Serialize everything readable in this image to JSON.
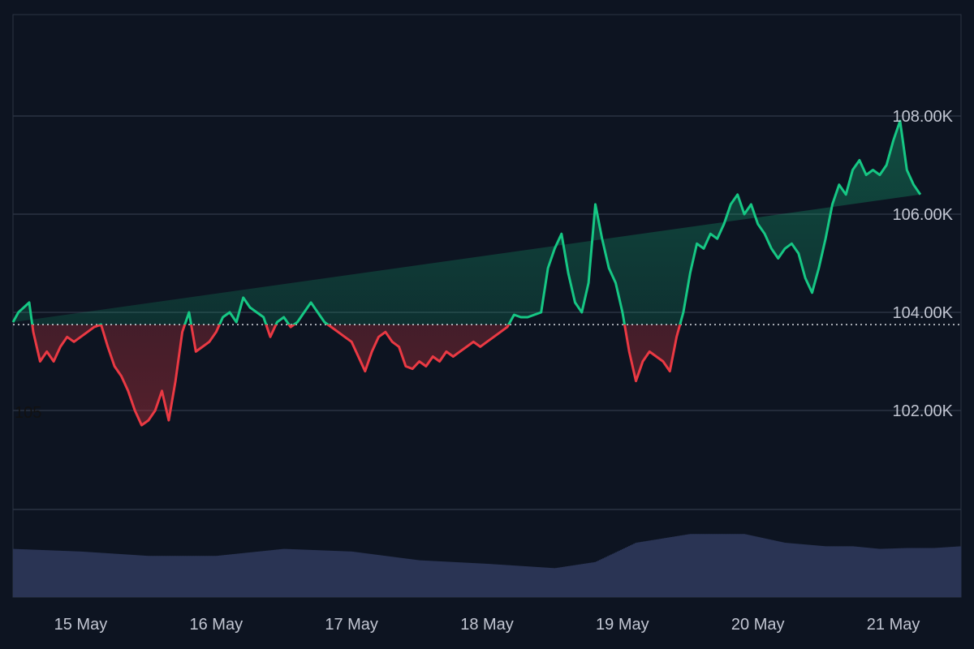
{
  "chart_data": {
    "type": "area",
    "baseline": 103.75,
    "y_unit_suffix": "K",
    "ylim": [
      100.0,
      110.0
    ],
    "y_ticks": [
      {
        "value": 102.0,
        "label": "102.00K"
      },
      {
        "value": 104.0,
        "label": "104.00K"
      },
      {
        "value": 106.0,
        "label": "106.00K"
      },
      {
        "value": 108.0,
        "label": "108.00K"
      }
    ],
    "stray_label": "105",
    "x_labels": [
      "15 May",
      "16 May",
      "17 May",
      "18 May",
      "19 May",
      "20 May",
      "21 May"
    ],
    "x_label_positions": [
      0.5,
      1.5,
      2.5,
      3.5,
      4.5,
      5.5,
      6.5
    ],
    "xlim": [
      0.0,
      7.0
    ],
    "grid": true,
    "colors": {
      "background": "#0d1421",
      "up": "#16c784",
      "down": "#ea3943",
      "up_fill": "#16c784",
      "down_fill": "#ea3943",
      "grid": "#2b3343",
      "baseline": "#d6d9e0",
      "volume": "#2a3454",
      "text": "#c2c6d2"
    },
    "price": {
      "x": [
        0.0,
        0.04,
        0.08,
        0.12,
        0.15,
        0.2,
        0.25,
        0.3,
        0.35,
        0.4,
        0.45,
        0.5,
        0.55,
        0.6,
        0.65,
        0.7,
        0.75,
        0.8,
        0.85,
        0.9,
        0.95,
        1.0,
        1.05,
        1.1,
        1.15,
        1.2,
        1.25,
        1.3,
        1.35,
        1.4,
        1.45,
        1.5,
        1.55,
        1.6,
        1.65,
        1.7,
        1.75,
        1.8,
        1.85,
        1.9,
        1.95,
        2.0,
        2.05,
        2.1,
        2.15,
        2.2,
        2.25,
        2.3,
        2.35,
        2.4,
        2.45,
        2.5,
        2.55,
        2.6,
        2.65,
        2.7,
        2.75,
        2.8,
        2.85,
        2.9,
        2.95,
        3.0,
        3.05,
        3.1,
        3.15,
        3.2,
        3.25,
        3.3,
        3.35,
        3.4,
        3.45,
        3.5,
        3.55,
        3.6,
        3.65,
        3.7,
        3.75,
        3.8,
        3.85,
        3.9,
        3.95,
        4.0,
        4.05,
        4.1,
        4.15,
        4.2,
        4.25,
        4.3,
        4.35,
        4.4,
        4.45,
        4.5,
        4.55,
        4.6,
        4.65,
        4.7,
        4.75,
        4.8,
        4.85,
        4.9,
        4.95,
        5.0,
        5.05,
        5.1,
        5.15,
        5.2,
        5.25,
        5.3,
        5.35,
        5.4,
        5.45,
        5.5,
        5.55,
        5.6,
        5.65,
        5.7,
        5.75,
        5.8,
        5.85,
        5.9,
        5.95,
        6.0,
        6.05,
        6.1,
        6.15,
        6.2,
        6.25,
        6.3,
        6.35,
        6.4,
        6.45,
        6.5,
        6.55,
        6.6,
        6.65,
        6.7,
        6.75,
        6.8,
        6.85,
        6.9,
        6.95,
        7.0
      ],
      "y": [
        103.8,
        104.0,
        104.1,
        104.2,
        103.6,
        103.0,
        103.2,
        103.0,
        103.3,
        103.5,
        103.4,
        103.5,
        103.6,
        103.7,
        103.75,
        103.3,
        102.9,
        102.7,
        102.4,
        102.0,
        101.7,
        101.8,
        102.0,
        102.4,
        101.8,
        102.6,
        103.6,
        104.0,
        103.2,
        103.3,
        103.4,
        103.6,
        103.9,
        104.0,
        103.8,
        104.3,
        104.1,
        104.0,
        103.9,
        103.5,
        103.8,
        103.9,
        103.7,
        103.8,
        104.0,
        104.2,
        104.0,
        103.8,
        103.7,
        103.6,
        103.5,
        103.4,
        103.1,
        102.8,
        103.2,
        103.5,
        103.6,
        103.4,
        103.3,
        102.9,
        102.85,
        103.0,
        102.9,
        103.1,
        103.0,
        103.2,
        103.1,
        103.2,
        103.3,
        103.4,
        103.3,
        103.4,
        103.5,
        103.6,
        103.7,
        103.95,
        103.9,
        103.9,
        103.95,
        104.0,
        104.9,
        105.3,
        105.6,
        104.8,
        104.2,
        104.0,
        104.6,
        106.2,
        105.5,
        104.9,
        104.6,
        104.0,
        103.2,
        102.6,
        103.0,
        103.2,
        103.1,
        103.0,
        102.8,
        103.5,
        104.0,
        104.8,
        105.4,
        105.3,
        105.6,
        105.5,
        105.8,
        106.2,
        106.4,
        106.0,
        106.2,
        105.8,
        105.6,
        105.3,
        105.1,
        105.3,
        105.4,
        105.2,
        104.7,
        104.4,
        104.9,
        105.5,
        106.2,
        106.6,
        106.4,
        106.9,
        107.1,
        106.8,
        106.9,
        106.8,
        107.0,
        107.5,
        107.9,
        106.9,
        106.6,
        106.4
      ]
    },
    "volume": {
      "x": [
        0.0,
        0.5,
        1.0,
        1.5,
        2.0,
        2.5,
        3.0,
        3.5,
        4.0,
        4.3,
        4.6,
        5.0,
        5.4,
        5.7,
        6.0,
        6.2,
        6.4,
        6.6,
        6.8,
        7.0
      ],
      "y": [
        0.55,
        0.52,
        0.47,
        0.47,
        0.55,
        0.52,
        0.42,
        0.38,
        0.33,
        0.4,
        0.62,
        0.72,
        0.72,
        0.62,
        0.58,
        0.58,
        0.55,
        0.56,
        0.56,
        0.58
      ]
    }
  }
}
